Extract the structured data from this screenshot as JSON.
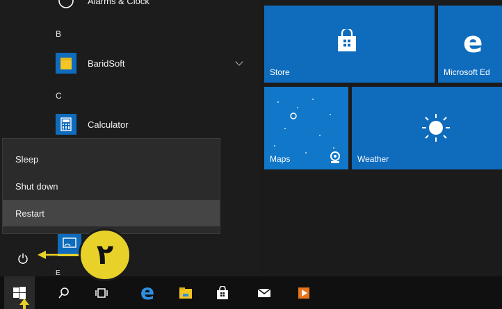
{
  "start_menu": {
    "top_partial_app": "Alarms & Clock",
    "sections": [
      {
        "letter": "B",
        "apps": [
          {
            "label": "BaridSoft",
            "icon": "folder-icon",
            "expandable": true
          }
        ]
      },
      {
        "letter": "C",
        "apps": [
          {
            "label": "Calculator",
            "icon": "calculator-icon"
          }
        ]
      },
      {
        "letter": "E"
      }
    ],
    "power_icon": "power-icon"
  },
  "power_menu": {
    "items": [
      "Sleep",
      "Shut down",
      "Restart"
    ],
    "selected": "Restart"
  },
  "tiles": [
    {
      "label": "Store",
      "icon": "store-bag-icon"
    },
    {
      "label": "Microsoft Ed",
      "icon": "edge-icon"
    },
    {
      "label": "Maps",
      "icon": "maps-icon"
    },
    {
      "label": "Weather",
      "icon": "sun-icon"
    }
  ],
  "taskbar": {
    "icons": [
      "windows-start-icon",
      "search-icon",
      "task-view-icon",
      "edge-icon",
      "file-explorer-icon",
      "store-icon",
      "mail-icon",
      "media-player-icon"
    ]
  },
  "callout": {
    "text": "۲",
    "color": "#e8d22a"
  },
  "colors": {
    "accent": "#0f6cbd",
    "menu_bg": "#1c1c1c",
    "taskbar_bg": "#101010",
    "callout": "#e8d22a"
  }
}
